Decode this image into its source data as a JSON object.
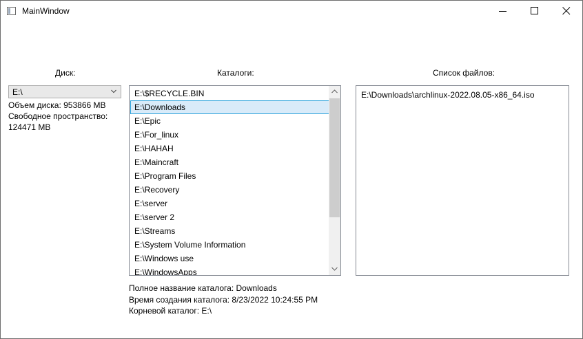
{
  "window": {
    "title": "MainWindow"
  },
  "drive": {
    "label": "Диск:",
    "selected": "E:\\",
    "size_text": "Объем диска: 953866 MB",
    "free_label": "Свободное пространство:",
    "free_value": "124471 MB"
  },
  "catalogs": {
    "label": "Каталоги:",
    "items": [
      "E:\\$RECYCLE.BIN",
      "E:\\Downloads",
      "E:\\Epic",
      "E:\\For_linux",
      "E:\\HAHAH",
      "E:\\Maincraft",
      "E:\\Program Files",
      "E:\\Recovery",
      "E:\\server",
      "E:\\server 2",
      "E:\\Streams",
      "E:\\System Volume Information",
      "E:\\Windows use",
      "E:\\WindowsApps"
    ],
    "selected_index": 1
  },
  "files": {
    "label": "Список файлов:",
    "items": [
      "E:\\Downloads\\archlinux-2022.08.05-x86_64.iso"
    ]
  },
  "info": {
    "full_name": "Полное название каталога: Downloads",
    "created": "Время создания каталога: 8/23/2022 10:24:55 PM",
    "root": "Корневой каталог: E:\\"
  },
  "icons": {
    "app": "window-app-icon",
    "minimize": "minimize-icon",
    "maximize": "maximize-icon",
    "close": "close-icon",
    "combo_arrow": "chevron-down-icon",
    "scroll_up": "scroll-up-arrow-icon",
    "scroll_down": "scroll-down-arrow-icon"
  }
}
